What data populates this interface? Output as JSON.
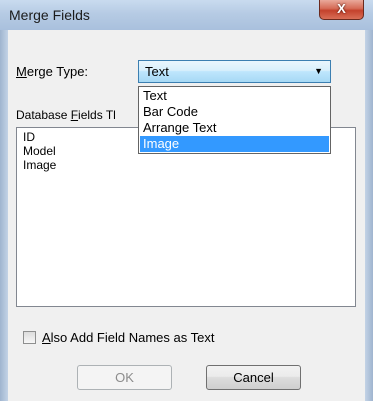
{
  "window": {
    "title": "Merge Fields",
    "close_glyph": "X"
  },
  "merge_type": {
    "label_accel": "M",
    "label_rest": "erge Type:",
    "selected": "Text",
    "options": [
      "Text",
      "Bar Code",
      "Arrange Text",
      "Image"
    ],
    "highlighted_index": 3
  },
  "database_fields": {
    "label_pre": "Database ",
    "label_accel": "F",
    "label_rest": "ields Tl",
    "items": [
      "ID",
      "Model",
      "Image"
    ]
  },
  "also_add": {
    "checked": false,
    "label_accel": "A",
    "label_rest": "lso Add Field Names as Text"
  },
  "buttons": {
    "ok": "OK",
    "cancel": "Cancel"
  }
}
